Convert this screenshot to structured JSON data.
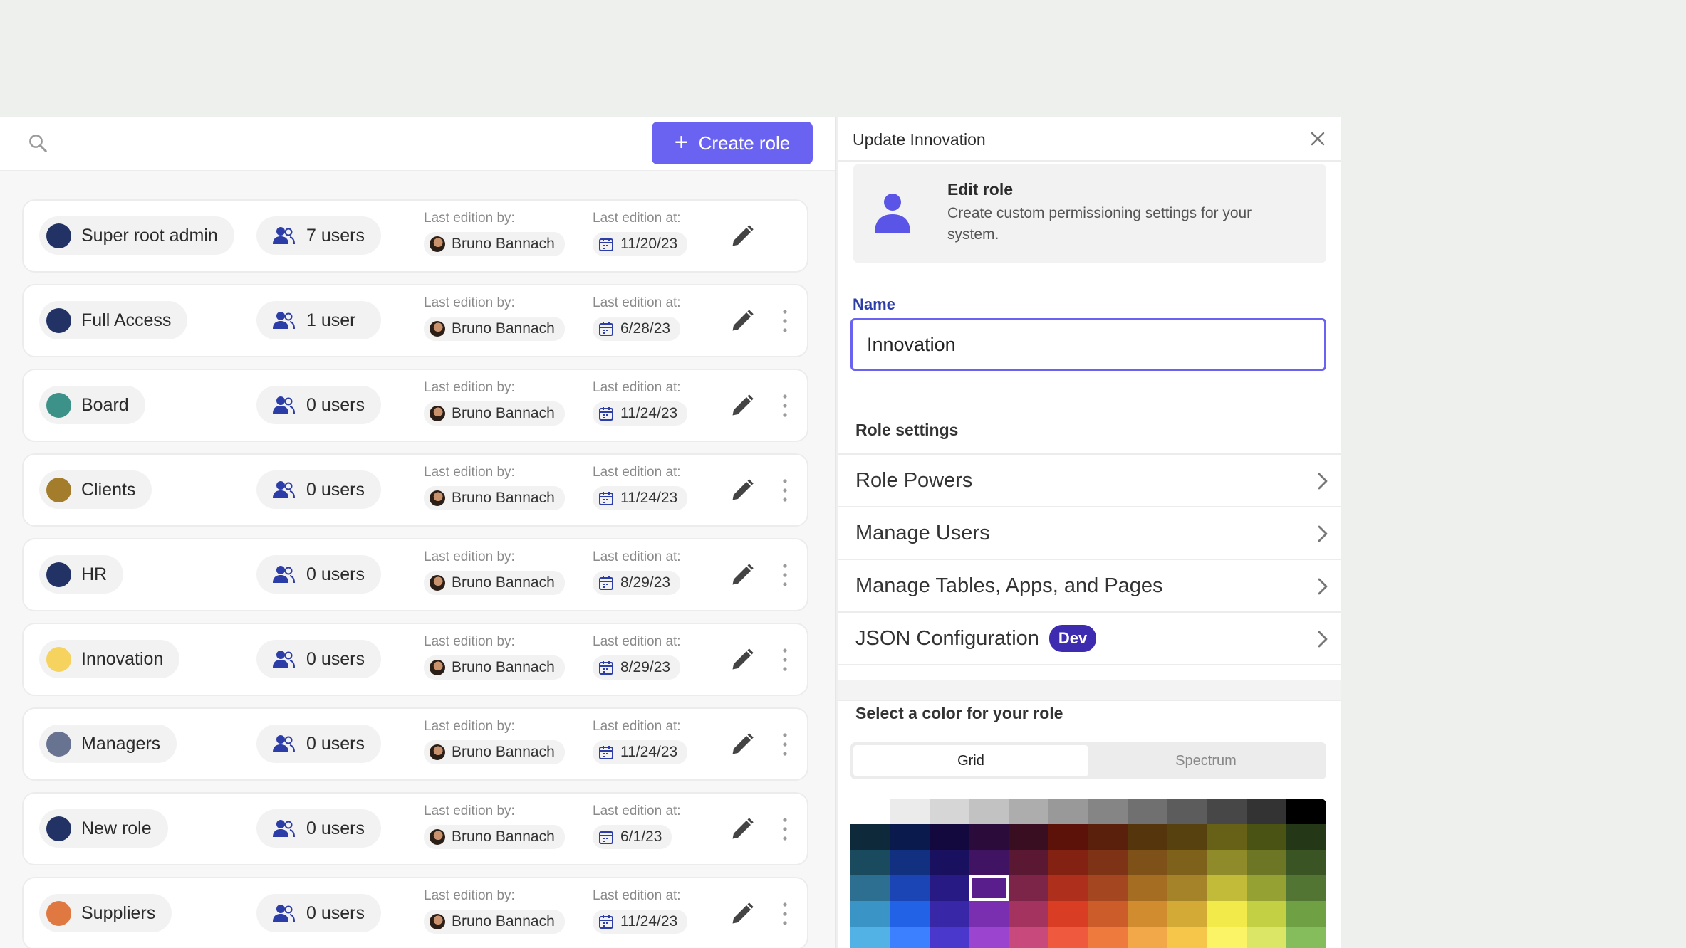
{
  "toolbar": {
    "search_placeholder": "",
    "create_label": "Create role"
  },
  "meta_labels": {
    "by": "Last edition by:",
    "at": "Last edition at:"
  },
  "roles": [
    {
      "name": "Super root admin",
      "color": "#223264",
      "users": "7 users",
      "editor": "Bruno Bannach",
      "date": "11/20/23",
      "has_menu": false
    },
    {
      "name": "Full Access",
      "color": "#223264",
      "users": "1 user",
      "editor": "Bruno Bannach",
      "date": "6/28/23",
      "has_menu": true
    },
    {
      "name": "Board",
      "color": "#3c9188",
      "users": "0 users",
      "editor": "Bruno Bannach",
      "date": "11/24/23",
      "has_menu": true
    },
    {
      "name": "Clients",
      "color": "#a37d2c",
      "users": "0 users",
      "editor": "Bruno Bannach",
      "date": "11/24/23",
      "has_menu": true
    },
    {
      "name": "HR",
      "color": "#223264",
      "users": "0 users",
      "editor": "Bruno Bannach",
      "date": "8/29/23",
      "has_menu": true
    },
    {
      "name": "Innovation",
      "color": "#f6d25f",
      "users": "0 users",
      "editor": "Bruno Bannach",
      "date": "8/29/23",
      "has_menu": true
    },
    {
      "name": "Managers",
      "color": "#677390",
      "users": "0 users",
      "editor": "Bruno Bannach",
      "date": "11/24/23",
      "has_menu": true
    },
    {
      "name": "New role",
      "color": "#223264",
      "users": "0 users",
      "editor": "Bruno Bannach",
      "date": "6/1/23",
      "has_menu": true
    },
    {
      "name": "Suppliers",
      "color": "#e07842",
      "users": "0 users",
      "editor": "Bruno Bannach",
      "date": "11/24/23",
      "has_menu": true
    }
  ],
  "panel": {
    "title": "Update Innovation",
    "info_title": "Edit role",
    "info_desc": "Create custom permissioning settings for your system.",
    "name_label": "Name",
    "name_value": "Innovation",
    "settings_title": "Role settings",
    "settings": [
      {
        "label": "Role Powers",
        "badge": ""
      },
      {
        "label": "Manage Users",
        "badge": ""
      },
      {
        "label": "Manage Tables, Apps, and Pages",
        "badge": ""
      },
      {
        "label": "JSON Configuration",
        "badge": "Dev"
      }
    ],
    "color_title": "Select a color for your role",
    "tabs": [
      "Grid",
      "Spectrum"
    ],
    "active_tab": "Grid",
    "palette": [
      [
        "#ffffff",
        "#ebebeb",
        "#d6d6d6",
        "#c2c2c2",
        "#adadad",
        "#999999",
        "#858585",
        "#707070",
        "#5c5c5c",
        "#474747",
        "#333333",
        "#000000"
      ],
      [
        "#0e2a3a",
        "#0b1a4d",
        "#13093f",
        "#2a0b3a",
        "#3a0e21",
        "#5c1209",
        "#5a200b",
        "#55350c",
        "#56410f",
        "#666117",
        "#4a5214",
        "#243817"
      ],
      [
        "#1a4a5e",
        "#123080",
        "#1a1060",
        "#401463",
        "#5a1832",
        "#832212",
        "#7f3316",
        "#7d5117",
        "#7e621c",
        "#8f8b2a",
        "#6c7625",
        "#3b5424"
      ],
      [
        "#2c6f91",
        "#1b45b5",
        "#281a85",
        "#5a1e8c",
        "#7d2449",
        "#ad2f1c",
        "#a4461f",
        "#a56d22",
        "#a58429",
        "#c2bb3a",
        "#96a133",
        "#527534"
      ],
      [
        "#3a94c6",
        "#2262e6",
        "#3828a8",
        "#7a2eb0",
        "#a53360",
        "#d93e25",
        "#cc5c2a",
        "#d18c2f",
        "#d4aa36",
        "#f2ea4a",
        "#c4d044",
        "#6fa044"
      ],
      [
        "#52b2e6",
        "#3c80ff",
        "#4a38cc",
        "#9a44d0",
        "#c84a7c",
        "#ef5a3e",
        "#ef7a3e",
        "#f2a848",
        "#f5c64a",
        "#fbf466",
        "#dbe666",
        "#86bd5c"
      ]
    ],
    "selected_color": "#5a1e8c"
  }
}
